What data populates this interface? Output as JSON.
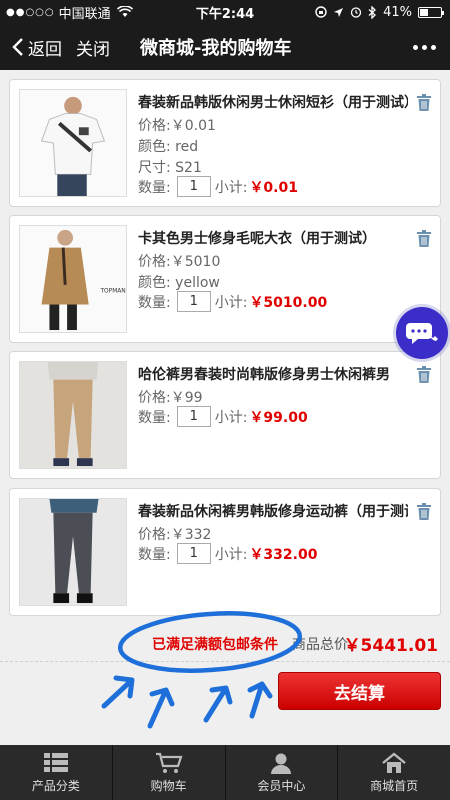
{
  "status_bar": {
    "carrier": "中国联通",
    "time": "下午2:44",
    "battery": "41%",
    "battery_level": 0.41
  },
  "nav": {
    "back_label": "返回",
    "close_label": "关闭",
    "title": "微商城-我的购物车"
  },
  "items": [
    {
      "name": "春装新品韩版休闲男士休闲短衫（用于测试）",
      "price_label": "价格:",
      "price": "￥0.01",
      "color_label": "颜色:",
      "color": "red",
      "size_label": "尺寸:",
      "size": "S21",
      "qty_label": "数量:",
      "qty": "1",
      "subtotal_label": "小计:",
      "subtotal": "￥0.01"
    },
    {
      "name": "卡其色男士修身毛呢大衣（用于测试）",
      "price_label": "价格:",
      "price": "￥5010",
      "color_label": "颜色:",
      "color": "yellow",
      "brand_tag": "TOPMAN",
      "qty_label": "数量:",
      "qty": "1",
      "subtotal_label": "小计:",
      "subtotal": "￥5010.00"
    },
    {
      "name": "哈伦裤男春装时尚韩版修身男士休闲裤男",
      "price_label": "价格:",
      "price": "￥99",
      "qty_label": "数量:",
      "qty": "1",
      "subtotal_label": "小计:",
      "subtotal": "￥99.00"
    },
    {
      "name": "春装新品休闲裤男韩版修身运动裤（用于测试）",
      "price_label": "价格:",
      "price": "￥332",
      "qty_label": "数量:",
      "qty": "1",
      "subtotal_label": "小计:",
      "subtotal": "￥332.00"
    }
  ],
  "summary": {
    "free_shipping": "已满足满额包邮条件",
    "total_label": "商品总价:",
    "total": "￥5441.01"
  },
  "checkout_label": "去结算",
  "tabs": [
    {
      "label": "产品分类",
      "icon": "category-icon"
    },
    {
      "label": "购物车",
      "icon": "cart-icon"
    },
    {
      "label": "会员中心",
      "icon": "user-icon"
    },
    {
      "label": "商城首页",
      "icon": "home-icon"
    }
  ],
  "colors": {
    "accent": "#e00000",
    "bar_bg": "#1b1b1b",
    "annotation_blue": "#1e6fd9",
    "chat_bubble": "#3a2dc8"
  }
}
